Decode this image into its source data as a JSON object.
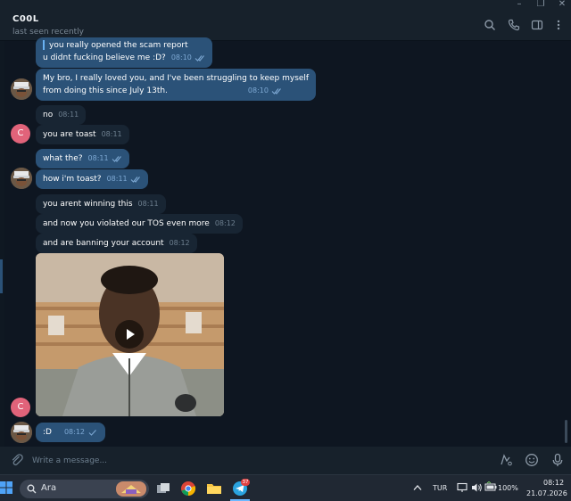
{
  "window": {
    "minimize": "–",
    "restore": "❐",
    "close": "✕"
  },
  "header": {
    "title": "C00L",
    "status": "last seen recently",
    "icons": [
      "search-icon",
      "phone-icon",
      "sidebar-toggle-icon",
      "more-vert-icon"
    ]
  },
  "messages": [
    {
      "dir": "out",
      "lines": [
        "you really opened the scam report",
        "u didnt fucking believe me :D?"
      ],
      "time": "08:10",
      "read": true
    },
    {
      "dir": "out",
      "lines": [
        "My bro, I really loved you, and I've been struggling to keep myself",
        "from doing this since July 13th."
      ],
      "time": "08:10",
      "read": true
    },
    {
      "dir": "in",
      "text": "no",
      "time": "08:11"
    },
    {
      "dir": "in",
      "text": "you are toast",
      "time": "08:11"
    },
    {
      "dir": "out",
      "text": "what the?",
      "time": "08:11",
      "read": true
    },
    {
      "dir": "out",
      "text": "how i'm toast?",
      "time": "08:11",
      "read": true
    },
    {
      "dir": "in",
      "text": "you arent winning this",
      "time": "08:11"
    },
    {
      "dir": "in",
      "text": "and now you violated our TOS even more",
      "time": "08:12"
    },
    {
      "dir": "in",
      "text": "and are banning your account",
      "time": "08:12"
    },
    {
      "dir": "out",
      "text": ":D",
      "time": "08:12",
      "read": false
    }
  ],
  "avatar_letter": "C",
  "input": {
    "placeholder": "Write a message..."
  },
  "taskbar": {
    "search_text": "Ara",
    "telegram_badge": "37",
    "language": "TUR",
    "battery": "100%",
    "time": "08:12",
    "date": "21.07.2026"
  },
  "colors": {
    "background": "#0e1621",
    "panel": "#17212b",
    "outgoing_bubble": "#2b5278",
    "incoming_bubble": "#182533",
    "avatar_pink": "#e1637a",
    "accent": "#6ab2f2"
  }
}
